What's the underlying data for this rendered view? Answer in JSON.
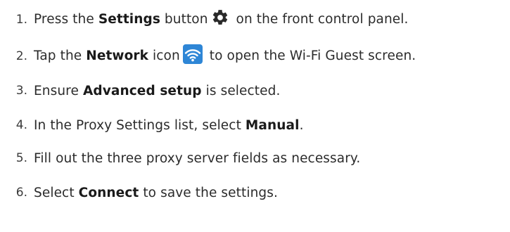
{
  "steps": [
    {
      "number": "1.",
      "before": "Press the ",
      "bold": "Settings",
      "after_bold": " button",
      "icon": "gear-icon",
      "after_icon": " on the front control panel."
    },
    {
      "number": "2.",
      "before": "Tap the ",
      "bold": "Network",
      "after_bold": " icon",
      "icon": "wifi-icon",
      "icon_color": "#2e86d6",
      "after_icon": " to open the Wi-Fi Guest screen."
    },
    {
      "number": "3.",
      "before": "Ensure ",
      "bold": "Advanced setup",
      "after_bold": " is selected."
    },
    {
      "number": "4.",
      "before": "In the Proxy Settings list, select ",
      "bold": "Manual",
      "after_bold": "."
    },
    {
      "number": "5.",
      "before": "Fill out the three proxy server fields as necessary."
    },
    {
      "number": "6.",
      "before": "Select ",
      "bold": "Connect",
      "after_bold": " to save the settings."
    }
  ]
}
